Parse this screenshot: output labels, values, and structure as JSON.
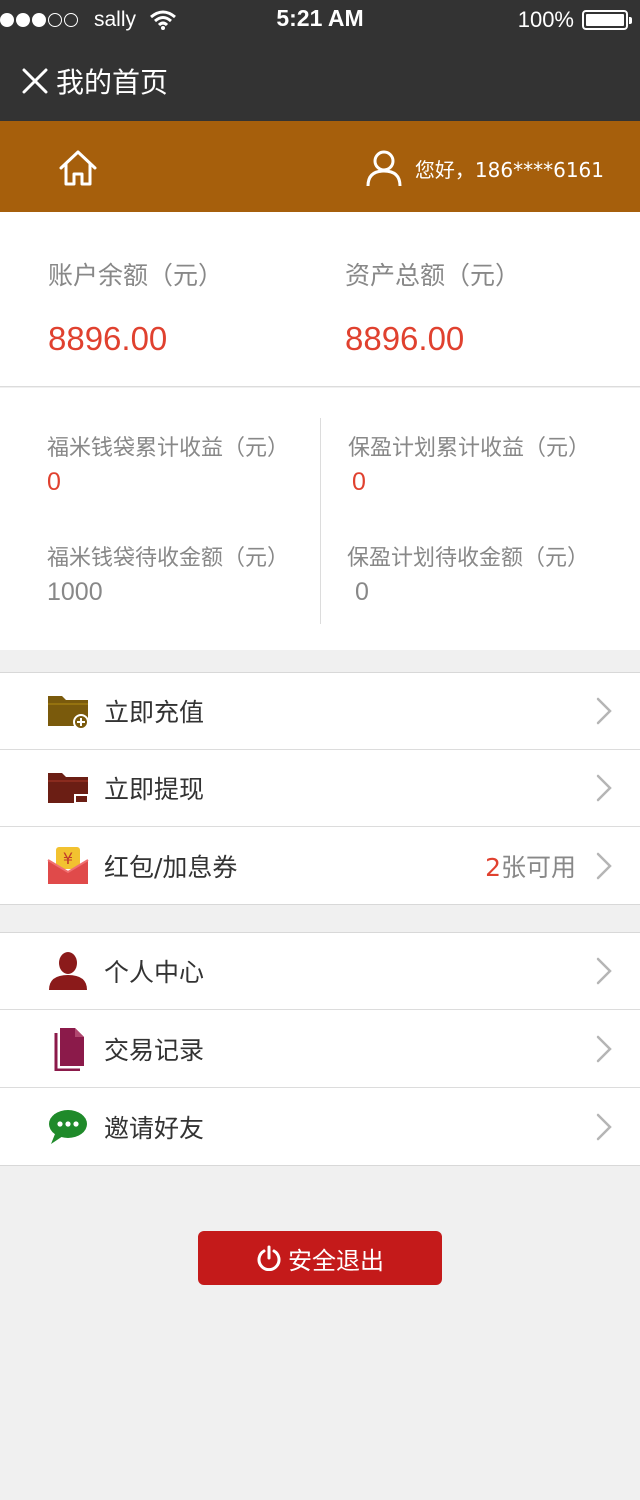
{
  "status_bar": {
    "carrier": "sally",
    "time": "5:21 AM",
    "battery": "100%",
    "signal_full": 3,
    "signal_total": 5
  },
  "nav": {
    "title": "我的首页",
    "close_icon": "close-icon"
  },
  "user_bar": {
    "home_icon": "home-icon",
    "user_icon": "user-icon",
    "greeting": "您好，186****6161"
  },
  "balance": {
    "account_label": "账户余额（元）",
    "account_value": "8896.00",
    "assets_label": "资产总额（元）",
    "assets_value": "8896.00"
  },
  "earnings": {
    "fumi_total_label": "福米钱袋累计收益（元）",
    "fumi_total_value": "0",
    "baoying_total_label": "保盈计划累计收益（元）",
    "baoying_total_value": "0",
    "fumi_pending_label": "福米钱袋待收金额（元）",
    "fumi_pending_value": "1000",
    "baoying_pending_label": "保盈计划待收金额（元）",
    "baoying_pending_value": "0"
  },
  "menu_group_1": [
    {
      "label": "立即充值",
      "icon": "folder-add-icon"
    },
    {
      "label": "立即提现",
      "icon": "folder-withdraw-icon"
    },
    {
      "label": "红包/加息券",
      "icon": "red-envelope-icon",
      "count": "2",
      "count_suffix": "张可用"
    }
  ],
  "menu_group_2": [
    {
      "label": "个人中心",
      "icon": "person-icon"
    },
    {
      "label": "交易记录",
      "icon": "document-icon"
    },
    {
      "label": "邀请好友",
      "icon": "chat-bubble-icon"
    }
  ],
  "logout": {
    "label": "安全退出",
    "icon": "power-icon"
  },
  "colors": {
    "header_dark": "#333333",
    "brand_orange": "#a65f0c",
    "accent_red": "#e0412f",
    "logout_red": "#c41a1a",
    "background": "#f0f0f0"
  }
}
